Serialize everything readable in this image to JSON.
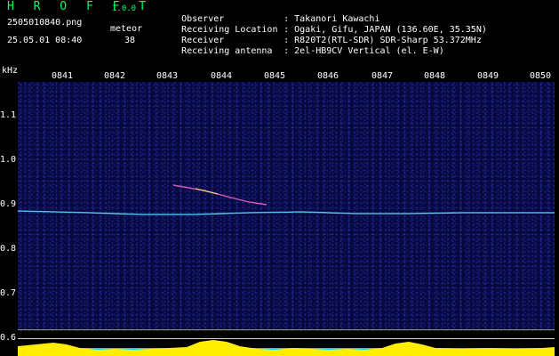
{
  "header": {
    "app_title": "H R O F F T",
    "version": "1.0.0",
    "filename": "2505010840.png",
    "datetime": "25.05.01 08:40",
    "meteor_label": "meteor",
    "meteor_count": "38"
  },
  "info": [
    {
      "label": "Observer",
      "value": ": Takanori Kawachi"
    },
    {
      "label": "Receiving Location",
      "value": ": Ogaki, Gifu, JAPAN (136.60E, 35.35N)"
    },
    {
      "label": "Receiver",
      "value": ": R820T2(RTL-SDR) SDR-Sharp 53.372MHz"
    },
    {
      "label": "Receiving antenna",
      "value": ": 2el-HB9CV Vertical (el. E-W)"
    }
  ],
  "axis": {
    "unit_label": "kHz",
    "time_ticks": [
      "0841",
      "0842",
      "0843",
      "0844",
      "0845",
      "0846",
      "0847",
      "0848",
      "0849",
      "0850"
    ],
    "freq_ticks": [
      "1.1",
      "1.0",
      "0.9",
      "0.8",
      "0.7",
      "0.6"
    ]
  },
  "colors": {
    "title_green": "#00ff66",
    "background": "#000000",
    "spectrogram_bg": "#06083f",
    "carrier": "#33aaff",
    "meteor_head": "#ff66cc",
    "activity_yellow": "#ffee00",
    "activity_cyan": "#00d8ff"
  }
}
